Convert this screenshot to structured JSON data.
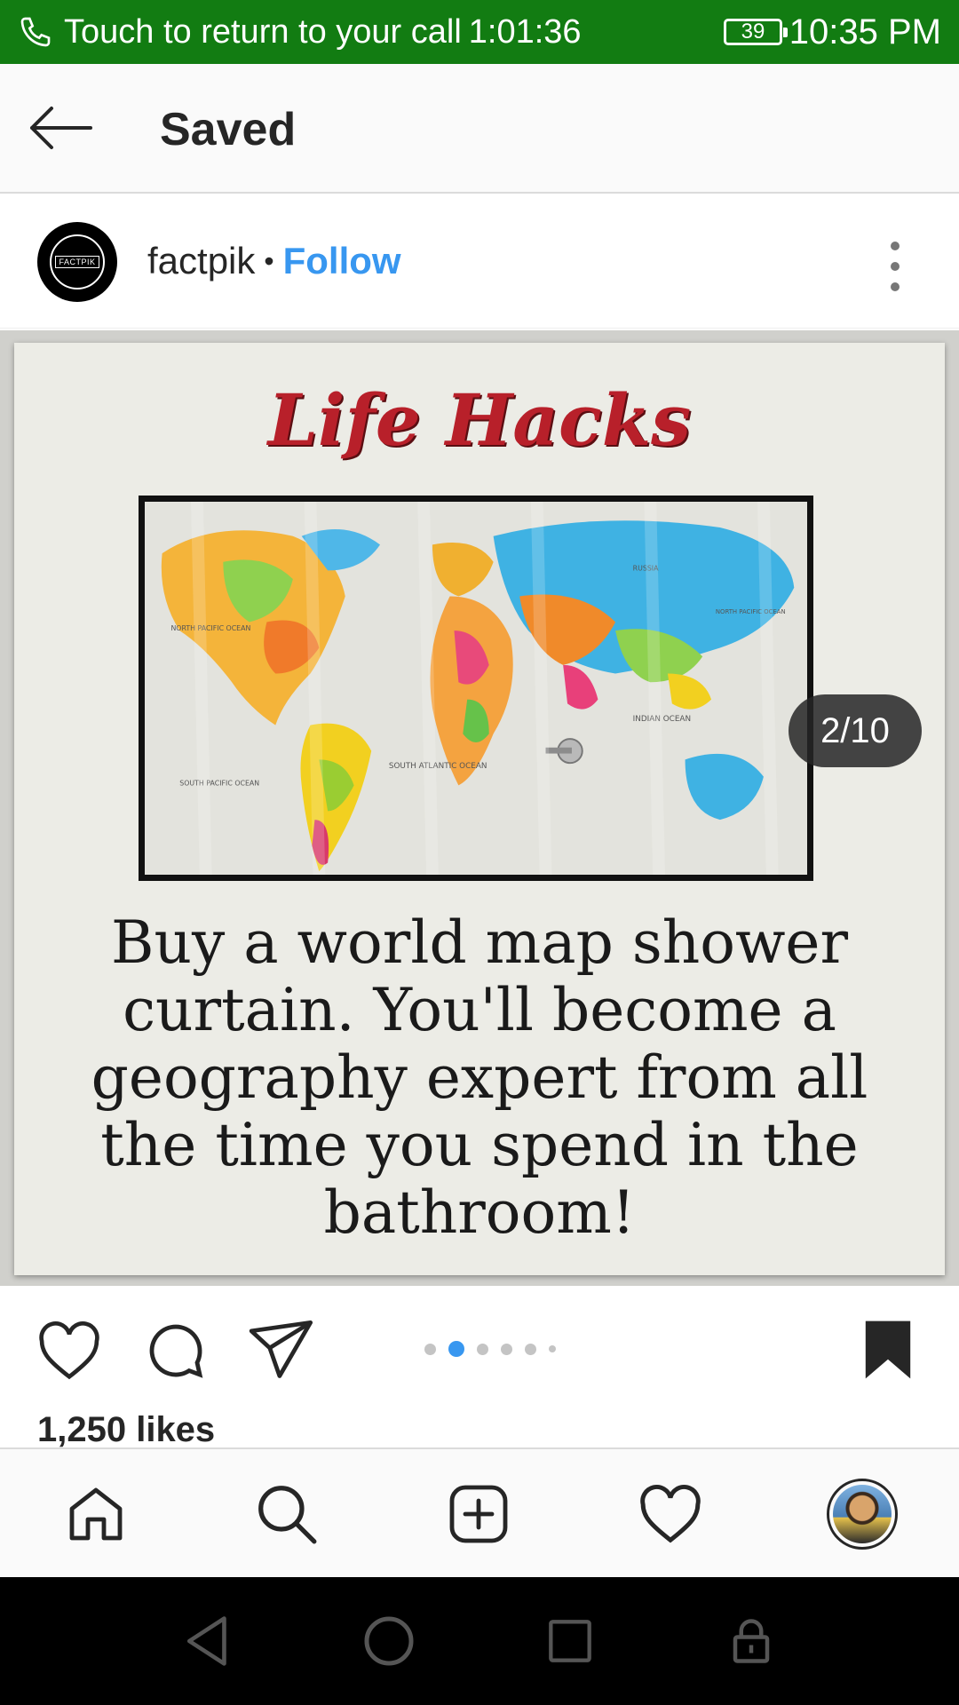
{
  "status_bar": {
    "call_text": "Touch to return to your call",
    "call_timer": "1:01:36",
    "battery": "39",
    "time": "10:35 PM",
    "background_color": "#127c12"
  },
  "header": {
    "title": "Saved",
    "back_icon": "arrow-left-icon"
  },
  "post": {
    "avatar_text": "FACTPIK",
    "username": "factpik",
    "separator": "•",
    "follow_label": "Follow",
    "follow_color": "#3897f0",
    "more_icon": "vertical-dots-icon",
    "image": {
      "title": "Life Hacks",
      "caption": "Buy a world map shower curtain. You'll become a geography expert from all the time you spend in the bathroom!",
      "map_labels": [
        "SOUTH ATLANTIC OCEAN",
        "INDIAN OCEAN",
        "NORTH PACIFIC OCEAN",
        "SOUTH PACIFIC OCEAN",
        "NORTH PACIFIC OCEAN",
        "RUSSIA"
      ]
    },
    "page_indicator": "2/10",
    "carousel": {
      "dot_count": 6,
      "active_index": 1
    },
    "actions": {
      "like_icon": "heart-icon",
      "comment_icon": "comment-bubble-icon",
      "share_icon": "paper-plane-icon",
      "save_icon": "bookmark-filled-icon"
    },
    "likes": "1,250 likes"
  },
  "bottom_nav": {
    "items": [
      {
        "icon": "home-icon"
      },
      {
        "icon": "search-icon"
      },
      {
        "icon": "add-post-icon"
      },
      {
        "icon": "activity-heart-icon"
      },
      {
        "icon": "profile-avatar-icon"
      }
    ]
  },
  "system_nav": {
    "items": [
      {
        "icon": "triangle-back-icon"
      },
      {
        "icon": "circle-home-icon"
      },
      {
        "icon": "square-recents-icon"
      },
      {
        "icon": "lock-icon"
      }
    ]
  }
}
